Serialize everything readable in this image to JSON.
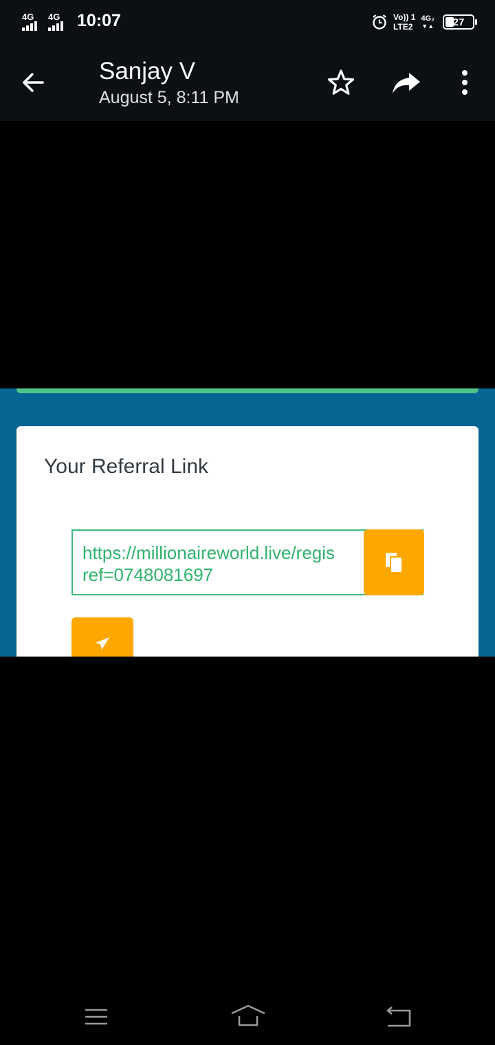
{
  "status_bar": {
    "network_1": "4G",
    "network_2": "4G",
    "time": "10:07",
    "volte_top": "Vo)) 1",
    "volte_bottom": "LTE2",
    "network_4g2": "4G₂",
    "battery_level": "27"
  },
  "header": {
    "sender_name": "Sanjay V",
    "date": "August 5, 8:11 PM"
  },
  "icons": {
    "back": "arrow-left-icon",
    "star": "star-outline-icon",
    "share": "share-icon",
    "more": "more-vert-icon",
    "copy": "copy-icon",
    "send": "send-icon",
    "nav_menu": "menu-icon",
    "nav_home": "home-icon",
    "nav_back": "back-icon"
  },
  "image_content": {
    "card_title": "Your Referral Link",
    "referral_link_line1": "https://millionaireworld.live/regis",
    "referral_link_line2": "ref=0748081697"
  },
  "colors": {
    "app_bar": "#0b1015",
    "photo_background": "#066592",
    "accent_green": "#3db87d",
    "button_orange": "#fea700"
  }
}
